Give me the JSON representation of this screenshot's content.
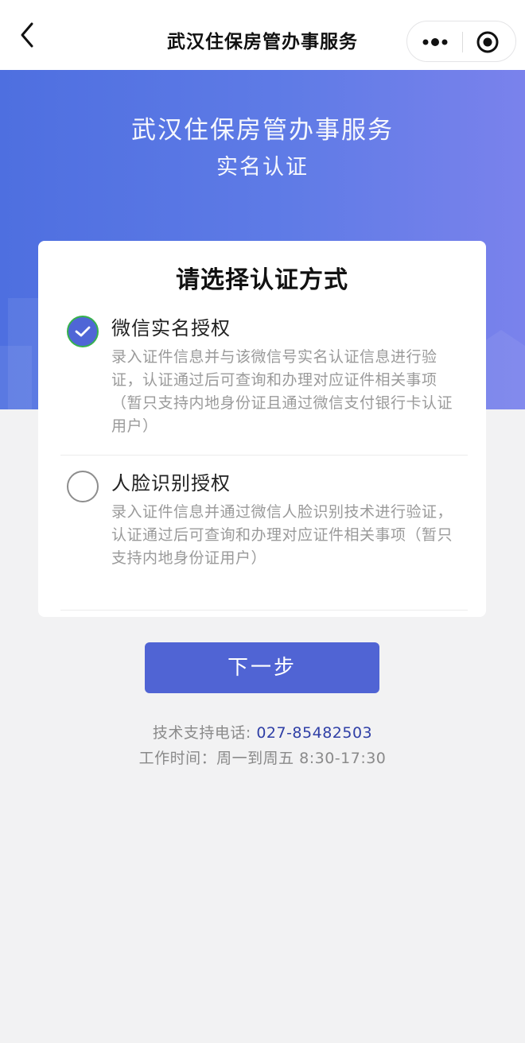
{
  "navbar": {
    "title": "武汉住保房管办事服务",
    "back_icon": "chevron-left-icon",
    "more_icon": "more-dots-icon",
    "close_icon": "target-circle-icon"
  },
  "hero": {
    "title": "武汉住保房管办事服务",
    "subtitle": "实名认证"
  },
  "card": {
    "title": "请选择认证方式",
    "options": [
      {
        "title": "微信实名授权",
        "description": "录入证件信息并与该微信号实名认证信息进行验证，认证通过后可查询和办理对应证件相关事项（暂只支持内地身份证且通过微信支付银行卡认证用户）",
        "selected": true
      },
      {
        "title": "人脸识别授权",
        "description": "录入证件信息并通过微信人脸识别技术进行验证，认证通过后可查询和办理对应证件相关事项（暂只支持内地身份证用户）",
        "selected": false
      }
    ]
  },
  "button": {
    "next_label": "下一步"
  },
  "support": {
    "phone_label": "技术支持电话: ",
    "phone_number": "027-85482503",
    "hours": "工作时间：周一到周五 8:30-17:30"
  },
  "colors": {
    "accent": "#5064d4",
    "hero_start": "#4e6fe0",
    "hero_end": "#7a82ec",
    "check_border": "#37b24d",
    "phone": "#2f3fa6"
  }
}
